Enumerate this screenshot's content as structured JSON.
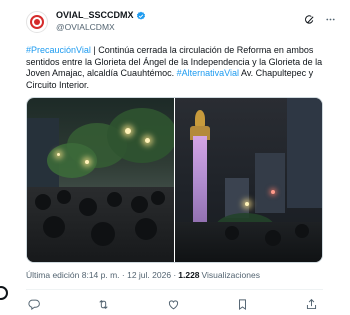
{
  "author": {
    "display_name": "OVIAL_SSCCDMX",
    "handle": "@OVIALCDMX"
  },
  "tweet": {
    "hashtag1": "#PrecauciónVial",
    "text1": " | Continúa cerrada la circulación de Reforma en ambos sentidos entre la Glorieta del Ángel de la Independencia y la Glorieta de la Joven Amajac, alcaldía Cuauhtémoc. ",
    "hashtag2": "#AlternativaVial",
    "text2": " Av. Chapultepec y Circuito Interior."
  },
  "meta": {
    "edited_label": "Última edición 8:14 p. m. · 12 jul. 2026 ·",
    "views_count": "1.228",
    "views_label": "Visualizaciones"
  },
  "colors": {
    "link": "#1d9bf0",
    "verified": "#1d9bf0",
    "brand_red": "#d52b2b",
    "muted": "#536471"
  },
  "icons": [
    "grok-icon",
    "more-icon",
    "reply-icon",
    "retweet-icon",
    "like-icon",
    "bookmark-icon",
    "share-icon",
    "verified-icon"
  ]
}
